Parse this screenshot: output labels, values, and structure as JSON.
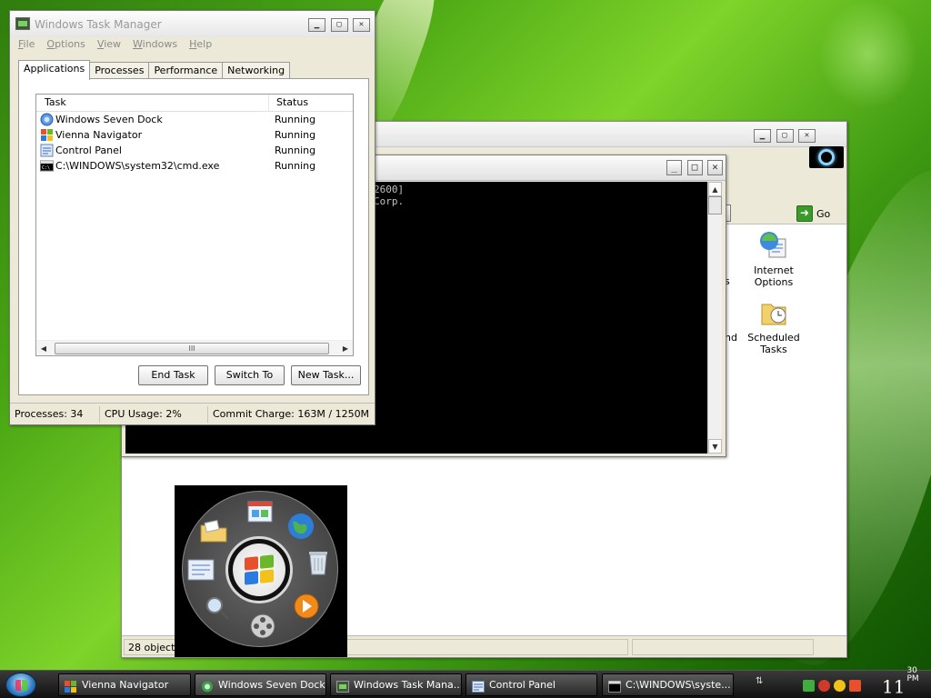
{
  "task_manager": {
    "title": "Windows Task Manager",
    "menu": [
      "File",
      "Options",
      "View",
      "Windows",
      "Help"
    ],
    "tabs": [
      "Applications",
      "Processes",
      "Performance",
      "Networking"
    ],
    "columns": {
      "task": "Task",
      "status": "Status"
    },
    "rows": [
      {
        "name": "Windows Seven Dock",
        "status": "Running",
        "icon": "dock-icon"
      },
      {
        "name": "Vienna Navigator",
        "status": "Running",
        "icon": "windows-flag-icon"
      },
      {
        "name": "Control Panel",
        "status": "Running",
        "icon": "control-panel-icon"
      },
      {
        "name": "C:\\WINDOWS\\system32\\cmd.exe",
        "status": "Running",
        "icon": "cmd-icon"
      }
    ],
    "scroll_grip": "III",
    "buttons": {
      "end_task": "End Task",
      "switch_to": "Switch To",
      "new_task": "New Task..."
    },
    "status": {
      "processes": "Processes: 34",
      "cpu": "CPU Usage: 2%",
      "commit": "Commit Charge: 163M / 1250M"
    }
  },
  "console": {
    "lines": [
      "2600]",
      "Corp."
    ]
  },
  "control_panel": {
    "go_label": "Go",
    "icons": [
      {
        "label_1": "Internet",
        "label_2": "Options",
        "icon": "internet-options-icon"
      },
      {
        "label_1": "Scheduled",
        "label_2": "Tasks",
        "icon": "scheduled-tasks-icon"
      }
    ],
    "partial_labels": {
      "a": "s",
      "b": "nd"
    },
    "status_count": "28 objects"
  },
  "dock": {
    "items": [
      "folder-icon",
      "window-icon",
      "globe-icon",
      "recycle-bin-icon",
      "media-player-icon",
      "film-reel-icon",
      "search-icon",
      "control-panel-icon"
    ]
  },
  "taskbar": {
    "buttons": [
      {
        "label": "Vienna Navigator",
        "icon": "windows-flag-icon"
      },
      {
        "label": "Windows Seven Dock",
        "icon": "dock-icon"
      },
      {
        "label": "Windows Task Mana...",
        "icon": "task-manager-icon"
      },
      {
        "label": "Control Panel",
        "icon": "control-panel-icon"
      },
      {
        "label": "C:\\WINDOWS\\syste...",
        "icon": "cmd-icon"
      }
    ],
    "clock": {
      "hour": "11",
      "minutes": "30",
      "ampm": "PM"
    }
  },
  "colors": {
    "window_face": "#ece9d8",
    "console_bg": "#000000",
    "taskbar": "#1e1e1e"
  }
}
